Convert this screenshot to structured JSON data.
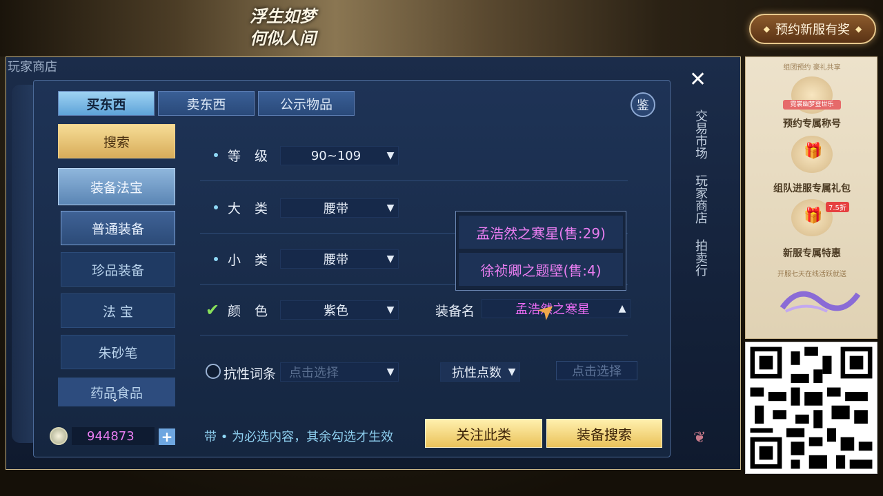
{
  "banner": {
    "title_line1": "浮生如梦",
    "title_line2": "何似人间",
    "reserve_label": "预约新服有奖"
  },
  "game": {
    "window_title": "玩家商店",
    "vertical_nav": [
      "交易市场",
      "玩家商店",
      "拍卖行"
    ],
    "tabs": [
      {
        "label": "买东西",
        "active": true
      },
      {
        "label": "卖东西",
        "active": false
      },
      {
        "label": "公示物品",
        "active": false
      }
    ],
    "jian_label": "鉴",
    "sidebar": [
      {
        "label": "搜索",
        "kind": "search"
      },
      {
        "label": "装备法宝",
        "kind": "cat"
      },
      {
        "label": "普通装备",
        "kind": "sub"
      },
      {
        "label": "珍品装备",
        "kind": "normal"
      },
      {
        "label": "法 宝",
        "kind": "normal"
      },
      {
        "label": "朱砂笔",
        "kind": "normal"
      },
      {
        "label": "药品食品",
        "kind": "normal"
      }
    ],
    "filters": {
      "level": {
        "label": "等级",
        "value": "90~109"
      },
      "major": {
        "label": "大类",
        "value": "腰带"
      },
      "minor": {
        "label": "小类",
        "value": "腰带"
      },
      "color": {
        "label": "颜色",
        "value": "紫色"
      },
      "equip_name": {
        "label": "装备名",
        "value": "孟浩然之寒星"
      },
      "resist_entry": {
        "label": "抗性词条",
        "placeholder": "点击选择"
      },
      "resist_points": {
        "label": "抗性点数",
        "placeholder": "点击选择"
      }
    },
    "dropdown_options": [
      "孟浩然之寒星(售:29)",
      "徐祯卿之题壁(售:4)"
    ],
    "currency": "944873",
    "hint_prefix": "带",
    "hint_text": "为必选内容，其余勾选才生效",
    "follow_button": "关注此类",
    "search_button": "装备搜索"
  },
  "promo": {
    "top_text": "组团预约 豪礼共享",
    "badge": "霓裳幽梦登世乐",
    "item1": "预约专属称号",
    "item2": "组队进服专属礼包",
    "item3": "新服专属特惠",
    "sale": "7.5折",
    "bottom_text": "开服七天在线活跃就送"
  },
  "colors": {
    "accent_gold": "#eac25a",
    "selection_pink": "#e86bf2",
    "panel_blue": "#1e3356"
  }
}
